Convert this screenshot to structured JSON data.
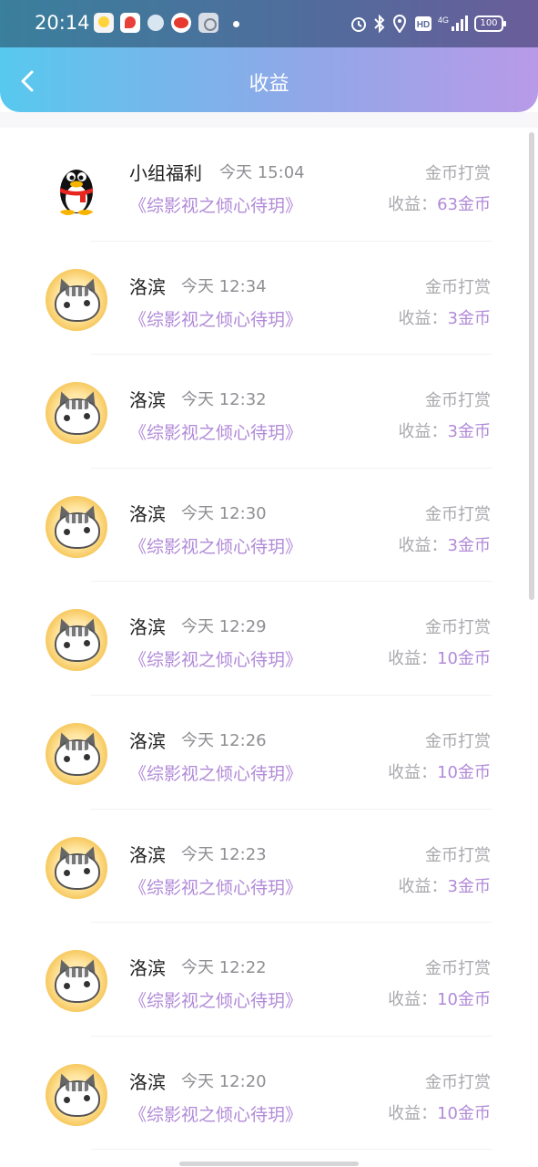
{
  "status": {
    "time": "20:14",
    "battery": "100",
    "icons": [
      "app-notification-1",
      "app-notification-2",
      "app-notification-3",
      "weibo-icon",
      "settings-icon",
      "alarm-icon",
      "bluetooth-icon",
      "location-icon",
      "hd-icon",
      "signal-4g-icon",
      "battery-icon"
    ]
  },
  "header": {
    "title": "收益",
    "back_icon": "chevron-left-icon"
  },
  "colors": {
    "accent": "#b18ad8",
    "header_start": "#57c9ee",
    "header_end": "#b89ae8"
  },
  "rows": [
    {
      "name": "小组福利",
      "time": "今天 15:04",
      "book": "《综影视之倾心待玥》",
      "type": "金币打赏",
      "earn_label": "收益：",
      "amount": "63金币",
      "avatar": "qq-penguin"
    },
    {
      "name": "洛滨",
      "time": "今天 12:34",
      "book": "《综影视之倾心待玥》",
      "type": "金币打赏",
      "earn_label": "收益：",
      "amount": "3金币",
      "avatar": "cat"
    },
    {
      "name": "洛滨",
      "time": "今天 12:32",
      "book": "《综影视之倾心待玥》",
      "type": "金币打赏",
      "earn_label": "收益：",
      "amount": "3金币",
      "avatar": "cat"
    },
    {
      "name": "洛滨",
      "time": "今天 12:30",
      "book": "《综影视之倾心待玥》",
      "type": "金币打赏",
      "earn_label": "收益：",
      "amount": "3金币",
      "avatar": "cat"
    },
    {
      "name": "洛滨",
      "time": "今天 12:29",
      "book": "《综影视之倾心待玥》",
      "type": "金币打赏",
      "earn_label": "收益：",
      "amount": "10金币",
      "avatar": "cat"
    },
    {
      "name": "洛滨",
      "time": "今天 12:26",
      "book": "《综影视之倾心待玥》",
      "type": "金币打赏",
      "earn_label": "收益：",
      "amount": "10金币",
      "avatar": "cat"
    },
    {
      "name": "洛滨",
      "time": "今天 12:23",
      "book": "《综影视之倾心待玥》",
      "type": "金币打赏",
      "earn_label": "收益：",
      "amount": "3金币",
      "avatar": "cat"
    },
    {
      "name": "洛滨",
      "time": "今天 12:22",
      "book": "《综影视之倾心待玥》",
      "type": "金币打赏",
      "earn_label": "收益：",
      "amount": "10金币",
      "avatar": "cat"
    },
    {
      "name": "洛滨",
      "time": "今天 12:20",
      "book": "《综影视之倾心待玥》",
      "type": "金币打赏",
      "earn_label": "收益：",
      "amount": "10金币",
      "avatar": "cat"
    }
  ]
}
